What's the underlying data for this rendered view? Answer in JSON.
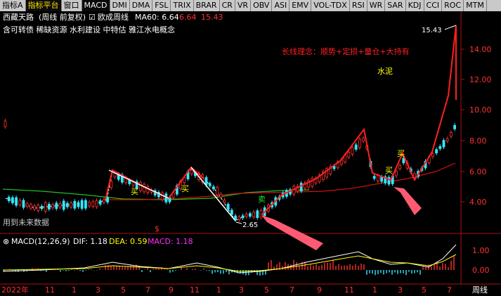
{
  "tabs": [
    {
      "label": "指标A",
      "state": "normal"
    },
    {
      "label": "指标平台",
      "state": "active"
    },
    {
      "label": "窗口",
      "state": "normal"
    },
    {
      "label": "MACD",
      "state": "ind-active"
    },
    {
      "label": "DMI",
      "state": "normal"
    },
    {
      "label": "DMA",
      "state": "normal"
    },
    {
      "label": "FSL",
      "state": "normal"
    },
    {
      "label": "TRIX",
      "state": "normal"
    },
    {
      "label": "BRAR",
      "state": "normal"
    },
    {
      "label": "CR",
      "state": "normal"
    },
    {
      "label": "VR",
      "state": "normal"
    },
    {
      "label": "OBV",
      "state": "normal"
    },
    {
      "label": "ASI",
      "state": "normal"
    },
    {
      "label": "EMV",
      "state": "normal"
    },
    {
      "label": "VOL-TDX",
      "state": "normal"
    },
    {
      "label": "RSI",
      "state": "normal"
    },
    {
      "label": "WR",
      "state": "normal"
    },
    {
      "label": "SAR",
      "state": "normal"
    },
    {
      "label": "KDJ",
      "state": "normal"
    },
    {
      "label": "CCI",
      "state": "normal"
    },
    {
      "label": "ROC",
      "state": "normal"
    },
    {
      "label": "MTM",
      "state": "normal"
    }
  ],
  "header": {
    "stock_name": "西藏天路",
    "mode": "(周线 前复权)",
    "checkbox_mark": "☑",
    "indicator": "欧成周线",
    "ma_label": "MA60: 6.64",
    "price_a": "6.64",
    "price_b": "15.43"
  },
  "concepts": "含可转债 稀缺资源 水利建设 中特估 雅江水电概念",
  "annotations": {
    "strategy": "长线理念：顺势+定损+量仓+大持有",
    "sector": "水泥",
    "top_price": "15.43",
    "low_price": "2.65",
    "future_data": "用到未来数据",
    "s_mark": "$",
    "buy_marks": [
      "买",
      "买",
      "买",
      "买"
    ],
    "sell_mark": "卖"
  },
  "colors": {
    "up": "#ff3030",
    "down": "#30e8ff",
    "ma": "#d01010",
    "green_line": "#20c020",
    "dif": "#ffffff",
    "dea": "#ffff00",
    "macd": "#ff30ff",
    "axis": "#b01010"
  },
  "price_axis": {
    "ticks": [
      "14.00",
      "12.00",
      "10.00",
      "8.00",
      "6.00",
      "4.00"
    ]
  },
  "macd": {
    "label": "MACD(12,26,9)",
    "dif": "DIF: 1.18",
    "dea": "DEA: 0.59",
    "macd": "MACD: 1.18",
    "ticks": [
      "1.00",
      "0.00"
    ],
    "close_icon": "⊗"
  },
  "time_axis": {
    "labels": [
      "2022年",
      "11",
      "1",
      "3",
      "5",
      "7",
      "9",
      "11",
      "1",
      "3",
      "5",
      "7",
      "9",
      "11",
      "1",
      "3",
      "5",
      "7"
    ],
    "period": "周线"
  }
}
